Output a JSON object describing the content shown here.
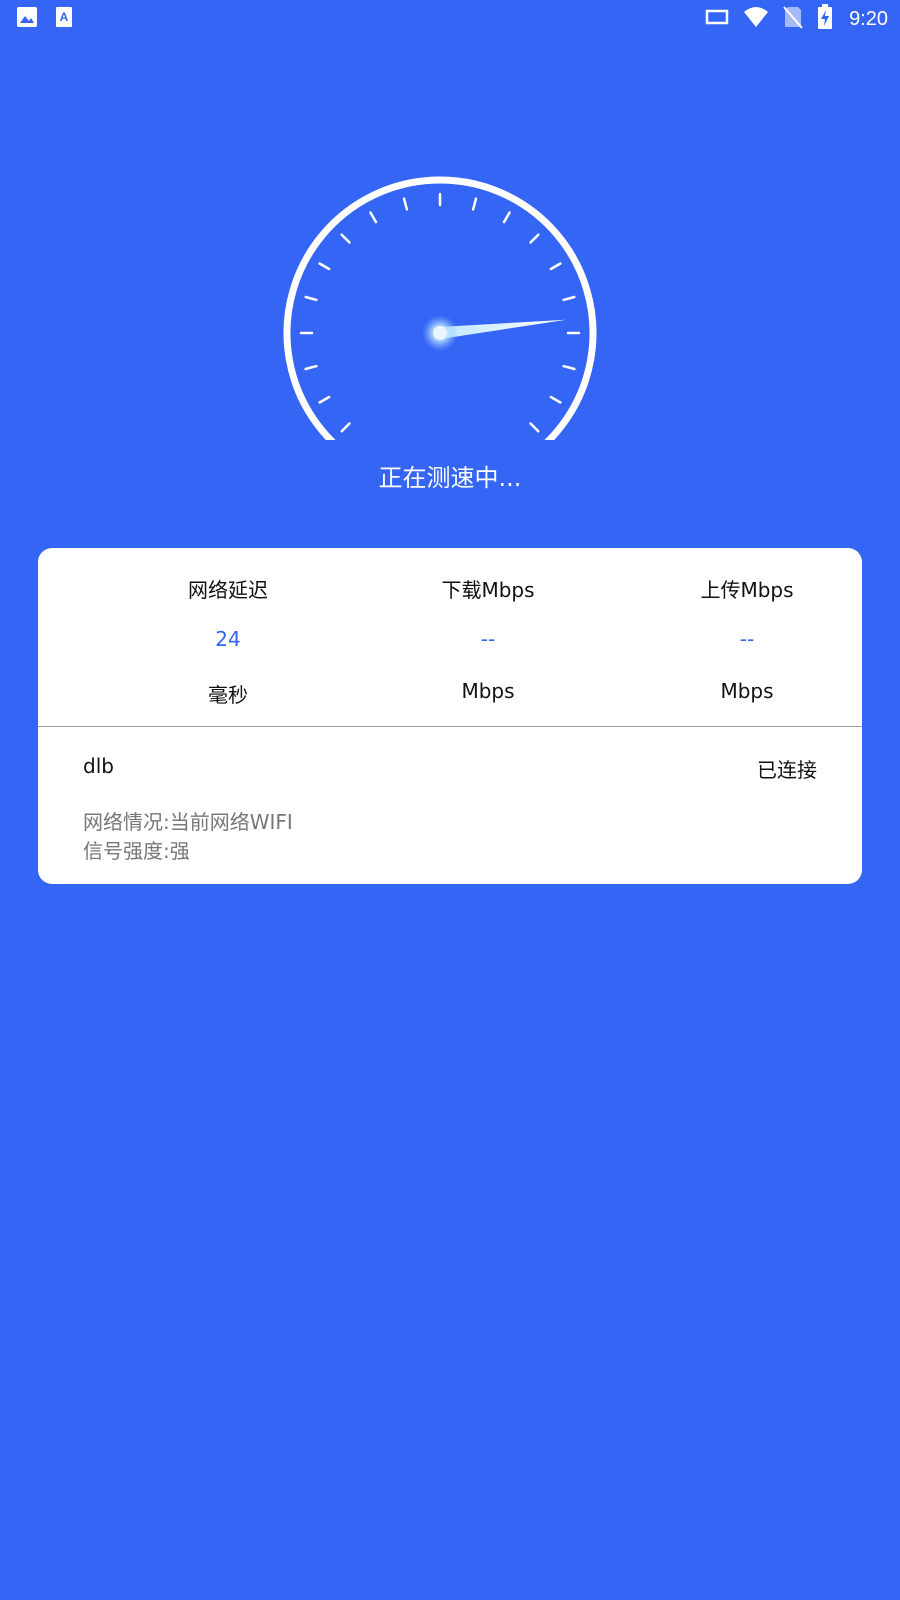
{
  "status_bar": {
    "time": "9:20",
    "left_icons": [
      "image-icon",
      "text-a-icon"
    ],
    "right_icons": [
      "cast-icon",
      "wifi-icon",
      "no-sim-icon",
      "battery-charging-icon"
    ]
  },
  "gauge": {
    "needle_fraction": 0.78
  },
  "status_text": "正在测速中...",
  "metrics": [
    {
      "label": "网络延迟",
      "value": "24",
      "unit": "毫秒"
    },
    {
      "label": "下载Mbps",
      "value": "--",
      "unit": "Mbps"
    },
    {
      "label": "上传Mbps",
      "value": "--",
      "unit": "Mbps"
    }
  ],
  "network": {
    "name": "dlb",
    "state": "已连接",
    "condition": "网络情况:当前网络WIFI",
    "signal": "信号强度:强"
  },
  "colors": {
    "background": "#3565F4",
    "accent": "#3565F4",
    "card": "#FFFFFF"
  }
}
